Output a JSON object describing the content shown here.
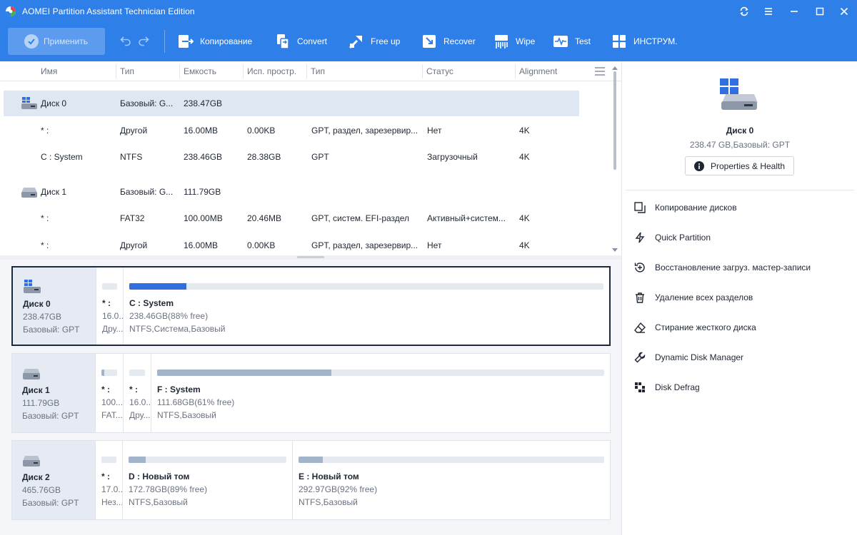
{
  "colors": {
    "toolbar_bg": "#2f7fe9",
    "selected_row": "#dfe7f3",
    "bar_fill": "#a3b3c9",
    "bar_fill_selected": "#2f6fe0"
  },
  "window": {
    "title": "AOMEI Partition Assistant Technician Edition"
  },
  "toolbar": {
    "apply_label": "Применить",
    "items": [
      {
        "label": "Копирование",
        "icon": "copy-arrow-icon"
      },
      {
        "label": "Convert",
        "icon": "convert-icon"
      },
      {
        "label": "Free up",
        "icon": "free-up-icon"
      },
      {
        "label": "Recover",
        "icon": "recover-icon"
      },
      {
        "label": "Wipe",
        "icon": "wipe-icon"
      },
      {
        "label": "Test",
        "icon": "test-icon"
      },
      {
        "label": "ИНСТРУМ.",
        "icon": "tools-icon"
      }
    ]
  },
  "table": {
    "columns": [
      "Имя",
      "Тип",
      "Емкость",
      "Исп. простр.",
      "Тип",
      "Статус",
      "Alignment"
    ],
    "rows": [
      {
        "kind": "disk",
        "name": "Диск 0",
        "type": "Базовый: G...",
        "capacity": "238.47GB",
        "used": "",
        "ptype": "",
        "status": "",
        "align": ""
      },
      {
        "kind": "part",
        "name": "* :",
        "type": "Другой",
        "capacity": "16.00MB",
        "used": "0.00KB",
        "ptype": "GPT, раздел, зарезервир...",
        "status": "Нет",
        "align": "4K"
      },
      {
        "kind": "part",
        "name": "C : System",
        "type": "NTFS",
        "capacity": "238.46GB",
        "used": "28.38GB",
        "ptype": "GPT",
        "status": "Загрузочный",
        "align": "4K"
      },
      {
        "kind": "disk",
        "name": "Диск 1",
        "type": "Базовый: G...",
        "capacity": "111.79GB",
        "used": "",
        "ptype": "",
        "status": "",
        "align": ""
      },
      {
        "kind": "part",
        "name": "* :",
        "type": "FAT32",
        "capacity": "100.00MB",
        "used": "20.46MB",
        "ptype": "GPT, систем. EFI-раздел",
        "status": "Активный+систем...",
        "align": "4K"
      },
      {
        "kind": "part",
        "name": "* :",
        "type": "Другой",
        "capacity": "16.00MB",
        "used": "0.00KB",
        "ptype": "GPT, раздел, зарезервир...",
        "status": "Нет",
        "align": "4K"
      }
    ]
  },
  "diskmap": [
    {
      "name": "Диск 0",
      "size": "238.47GB",
      "type": "Базовый: GPT",
      "partitions": [
        {
          "name": "* :",
          "size": "16.0...",
          "fs": "Дру...",
          "used_fraction": 0
        },
        {
          "name": "C : System",
          "size": "238.46GB(88% free)",
          "fs": "NTFS,Система,Базовый",
          "used_fraction": 0.12
        }
      ]
    },
    {
      "name": "Диск 1",
      "size": "111.79GB",
      "type": "Базовый: GPT",
      "partitions": [
        {
          "name": "* :",
          "size": "100...",
          "fs": "FAT...",
          "used_fraction": 0.2
        },
        {
          "name": "* :",
          "size": "16.0...",
          "fs": "Дру...",
          "used_fraction": 0
        },
        {
          "name": "F : System",
          "size": "111.68GB(61% free)",
          "fs": "NTFS,Базовый",
          "used_fraction": 0.39
        }
      ]
    },
    {
      "name": "Диск 2",
      "size": "465.76GB",
      "type": "Базовый: GPT",
      "partitions": [
        {
          "name": "* :",
          "size": "17.0...",
          "fs": "Нез...",
          "used_fraction": 0
        },
        {
          "name": "D : Новый том",
          "size": "172.78GB(89% free)",
          "fs": "NTFS,Базовый",
          "used_fraction": 0.11
        },
        {
          "name": "E : Новый том",
          "size": "292.97GB(92% free)",
          "fs": "NTFS,Базовый",
          "used_fraction": 0.08
        }
      ]
    }
  ],
  "right_panel": {
    "disk_name": "Диск 0",
    "disk_info": "238.47 GB,Базовый: GPT",
    "properties_label": "Properties & Health",
    "operations": [
      {
        "label": "Копирование дисков",
        "icon": "disk-copy-icon"
      },
      {
        "label": "Quick Partition",
        "icon": "lightning-icon"
      },
      {
        "label": "Восстановление загруз. мастер-записи",
        "icon": "rebuild-mbr-icon"
      },
      {
        "label": "Удаление всех разделов",
        "icon": "trash-icon"
      },
      {
        "label": "Стирание жесткого диска",
        "icon": "eraser-icon"
      },
      {
        "label": "Dynamic Disk Manager",
        "icon": "wrench-icon"
      },
      {
        "label": "Disk Defrag",
        "icon": "defrag-icon"
      }
    ]
  }
}
